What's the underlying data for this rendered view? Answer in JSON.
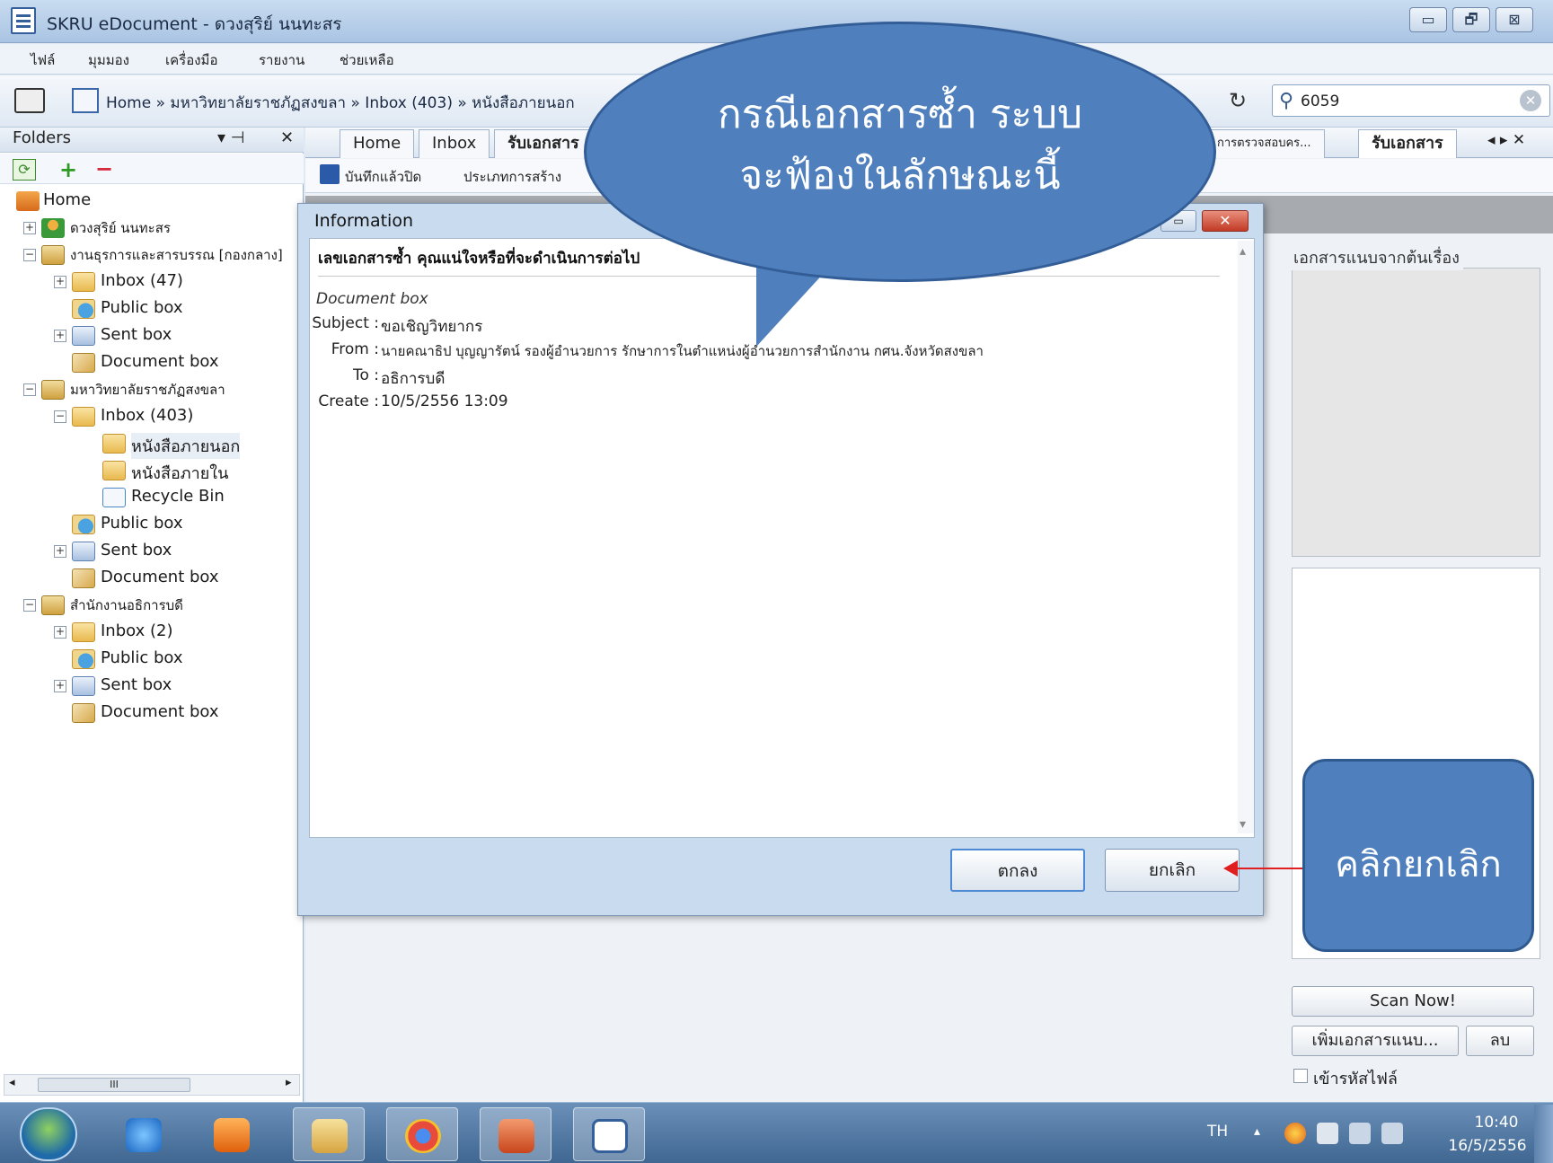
{
  "window": {
    "title": "SKRU eDocument - ดวงสุริย์ นนทะสร",
    "controls": [
      "▭",
      "🗗",
      "⊠"
    ]
  },
  "menu": [
    "ไฟล์",
    "มุมมอง",
    "เครื่องมือ",
    "รายงาน",
    "ช่วยเหลือ"
  ],
  "toolbar": {
    "breadcrumb": "Home » มหาวิทยาลัยราชภัฏสงขลา » Inbox (403) » หนังสือภายนอก",
    "search_value": "6059",
    "refresh": "↻",
    "search_clear": "✕"
  },
  "folders": {
    "title": "Folders",
    "pin": "▾  ⊣",
    "close": "✕",
    "refresh": "⟳",
    "add": "+",
    "remove": "−",
    "scroll_thumb": "III",
    "scroll_left": "◂",
    "scroll_right": "▸"
  },
  "tree": [
    {
      "label": "Home",
      "icon": "home-icon",
      "depth": 0,
      "exp": ""
    },
    {
      "label": "ดวงสุริย์ นนทะสร",
      "icon": "user-icon",
      "depth": 0,
      "exp": "+"
    },
    {
      "label": "งานธุรการและสารบรรณ [กองกลาง]",
      "icon": "cabinet-icon",
      "depth": 0,
      "exp": "−"
    },
    {
      "label": "Inbox (47)",
      "icon": "inbox-folder-icon",
      "depth": 1,
      "exp": "+"
    },
    {
      "label": "Public box",
      "icon": "public-box-icon",
      "depth": 1,
      "exp": ""
    },
    {
      "label": "Sent box",
      "icon": "sent-box-icon",
      "depth": 1,
      "exp": "+"
    },
    {
      "label": "Document box",
      "icon": "document-box-icon",
      "depth": 1,
      "exp": ""
    },
    {
      "label": "มหาวิทยาลัยราชภัฏสงขลา",
      "icon": "cabinet-icon",
      "depth": 0,
      "exp": "−"
    },
    {
      "label": "Inbox (403)",
      "icon": "inbox-folder-icon",
      "depth": 1,
      "exp": "−"
    },
    {
      "label": "หนังสือภายนอก",
      "icon": "folder-icon",
      "depth": 2,
      "exp": ""
    },
    {
      "label": "หนังสือภายใน",
      "icon": "folder-icon",
      "depth": 2,
      "exp": ""
    },
    {
      "label": "Recycle Bin",
      "icon": "recycle-bin-icon",
      "depth": 2,
      "exp": ""
    },
    {
      "label": "Public box",
      "icon": "public-box-icon",
      "depth": 1,
      "exp": ""
    },
    {
      "label": "Sent box",
      "icon": "sent-box-icon",
      "depth": 1,
      "exp": "+"
    },
    {
      "label": "Document box",
      "icon": "document-box-icon",
      "depth": 1,
      "exp": ""
    },
    {
      "label": "สำนักงานอธิการบดี",
      "icon": "cabinet-icon",
      "depth": 0,
      "exp": "−"
    },
    {
      "label": "Inbox (2)",
      "icon": "inbox-folder-icon",
      "depth": 1,
      "exp": "+"
    },
    {
      "label": "Public box",
      "icon": "public-box-icon",
      "depth": 1,
      "exp": ""
    },
    {
      "label": "Sent box",
      "icon": "sent-box-icon",
      "depth": 1,
      "exp": "+"
    },
    {
      "label": "Document box",
      "icon": "document-box-icon",
      "depth": 1,
      "exp": ""
    }
  ],
  "tabs": [
    "Home",
    "Inbox",
    "รับเอกสาร",
    "การตรวจสอบคร...",
    "รับเอกสาร"
  ],
  "tab_nav": "◂ ▸ ✕",
  "doc_toolbar": {
    "save_label": "บันทึกแล้วปิด",
    "type_label": "ประเภทการสร้าง"
  },
  "right_panel": {
    "group_label": "เอกสารแนบจากต้นเรื่อง",
    "scan_label": "Scan Now!",
    "add_attach_label": "เพิ่มเอกสารแนบ...",
    "delete_label": "ลบ",
    "encrypt_label": "เข้ารหัสไฟล์"
  },
  "dialog": {
    "title": "Information",
    "max": "▭",
    "close": "✕",
    "heading": "เลขเอกสารซ้ำ คุณแน่ใจหรือที่จะดำเนินการต่อไป",
    "box_label": "Document box",
    "fields": [
      {
        "label": "Subject :",
        "value": "ขอเชิญวิทยากร"
      },
      {
        "label": "From :",
        "value": "นายคณาธิป บุญญารัตน์ รองผู้อำนวยการ รักษาการในตำแหน่งผู้อำนวยการสำนักงาน กศน.จังหวัดสงขลา"
      },
      {
        "label": "To :",
        "value": "อธิการบดี"
      },
      {
        "label": "Create :",
        "value": "10/5/2556 13:09"
      }
    ],
    "ok_label": "ตกลง",
    "cancel_label": "ยกเลิก",
    "scroll_up": "▴",
    "scroll_down": "▾"
  },
  "callouts": {
    "top_line1": "กรณีเอกสารซ้ำ ระบบ",
    "top_line2": "จะฟ้องในลักษณะนี้",
    "side": "คลิกยกเลิก"
  },
  "taskbar": {
    "lang": "TH",
    "tray_up": "▴",
    "time": "10:40",
    "date": "16/5/2556"
  },
  "colors": {
    "callout": "#4f7fbd",
    "arrow": "#e02020",
    "taskbar": "#3f6791"
  }
}
